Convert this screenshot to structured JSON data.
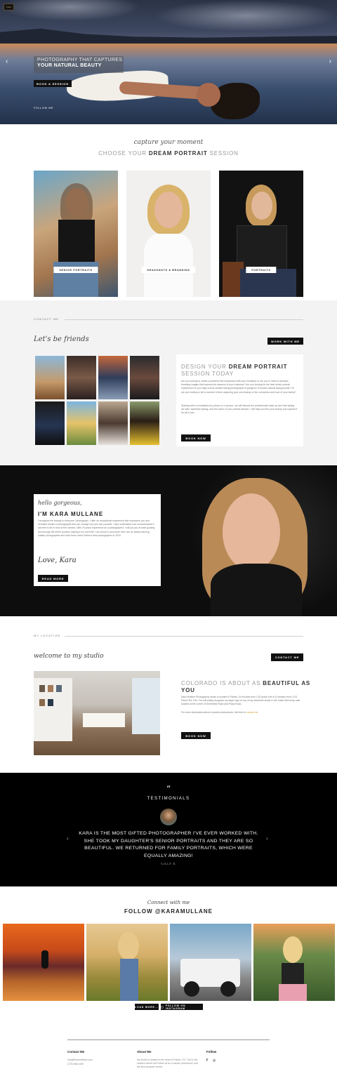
{
  "hero": {
    "caption_line1": "PHOTOGRAPHY THAT CAPTURES",
    "caption_line2": "YOUR NATURAL BEAUTY",
    "book_label": "BOOK A SESSION",
    "follow_label": "FOLLOW ME",
    "prev_icon": "chevron-left-icon",
    "next_icon": "chevron-right-icon",
    "logo_text": "Kara"
  },
  "choose": {
    "script": "capture your moment",
    "heading_prefix": "CHOOSE YOUR ",
    "heading_bold": "DREAM PORTRAIT",
    "heading_suffix": " SESSION",
    "cards": [
      {
        "label": "SENIOR PORTRAITS"
      },
      {
        "label": "HEADSHOTS & BRANDING"
      },
      {
        "label": "PORTRAITS"
      }
    ]
  },
  "contact": {
    "section_label": "CONTACT ME",
    "script": "Let's be friends",
    "work_button": "WORK WITH ME",
    "design_prefix": "DESIGN YOUR ",
    "design_bold": "DREAM PORTRAIT",
    "design_line2": "SESSION TODAY",
    "para1": "Are you looking to create a powerful first impression with your headshot or are you in need of dynamic branding images that express the essence of your business? Are you looking for the best senior portrait experience for your high-school student taking photographs in gorgeous Colorado natural backgrounds? Or are you looking to tell a moment in time capturing your own beauty or the connection and love of your family?",
    "para2": "Starting with a consultation by phone or in person, we will discuss the professional make-up and hair styling we offer, wardrobe styling, and the vision of your portrait session. I will help you find your beauty and capture it for all to see.",
    "book_now": "BOOK NOW"
  },
  "about": {
    "script": "hello gorgeous,",
    "title": "I'M KARA MULLANE",
    "para": "I recognize the beauty in everyone I photograph. I offer an exceptional experience that empowers you and revealed results in photographs that can change how you see yourself. I also understand how uncomfortable it can feel to be in front of the camera. With 20 years experience as a photographer, I will put you at ease guiding you through the entire process making it fun and free! I am proud to announce that I am an award-winning master photographer and have been voted Parker's best photographer in 2020.",
    "signature": "Love, Kara",
    "read_more": "READ MORE"
  },
  "location": {
    "section_label": "MY LOCATION",
    "script": "welcome to my studio",
    "contact_button": "CONTACT ME",
    "heading_prefix": "COLORADO IS ABOUT AS ",
    "heading_bold": "BEAUTIFUL AS",
    "heading_line2": "YOU",
    "para1": "Kara Mullane Photography studio is located in Parker, 15 minutes from I-25 (south exit or 8 minutes from I-470 Parker Rd. Exit. You will easily recognize my large logo on top of my storefront studio in the Cabin Mini shop mall located at the corner of Greenfield Road and Plaza Road.",
    "para2": "For more information about in-studio photoshoots, feel free to ",
    "para2_link": "contact me",
    "book_now": "BOOK NOW"
  },
  "testimonials": {
    "quote_icon": "quote-icon",
    "title": "TESTIMONIALS",
    "quote": "KARA IS THE MOST GIFTED PHOTOGRAPHER I'VE EVER WORKED WITH. SHE TOOK MY DAUGHTER'S SENIOR PORTRAITS AND THEY ARE SO BEAUTIFUL. WE RETURNED FOR FAMILY PORTRAITS, WHICH WERE EQUALLY AMAZING!",
    "author": "-LILLY S."
  },
  "instagram": {
    "script": "Connect with me",
    "heading": "FOLLOW @KARAMULLANE",
    "load_more": "LOAD MORE...",
    "follow_btn": "FOLLOW ON INSTAGRAM"
  },
  "footer": {
    "contact_title": "Contact Me",
    "email": "kara@karamullane.com",
    "phone": "(720) 666-4150",
    "about_title": "About Me",
    "about_text": "My studio is located in the heart of Parker, CO. This is the location where we'll either do an in-studio photoshoot, and the final products reveal.",
    "follow_title": "Follow",
    "social": [
      "facebook-icon",
      "instagram-icon"
    ]
  },
  "colors": {
    "accent_link": "#d4a235",
    "dark": "#111111"
  }
}
